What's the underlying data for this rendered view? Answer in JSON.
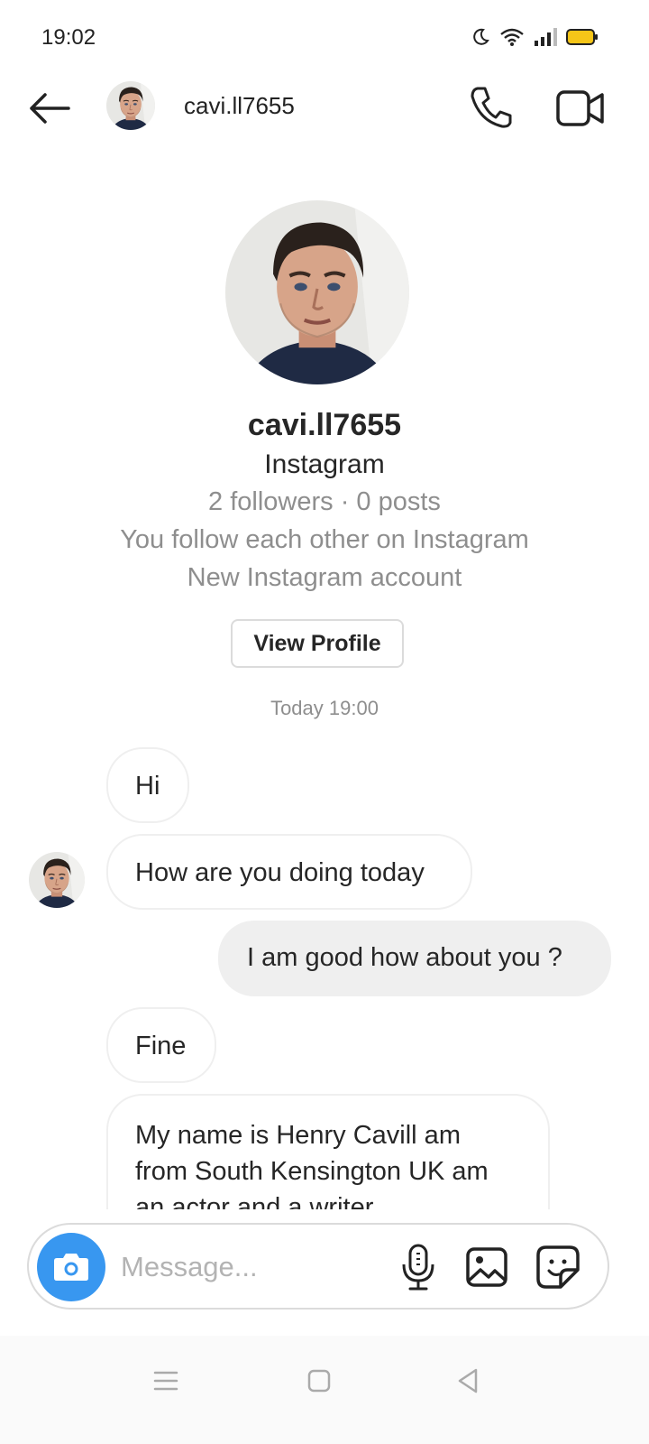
{
  "status_bar": {
    "time": "19:02",
    "icons": [
      "moon-icon",
      "wifi-icon",
      "signal-icon",
      "battery-icon"
    ]
  },
  "header": {
    "username": "cavi.ll7655",
    "back_icon": "arrow-left-icon",
    "call_icon": "phone-icon",
    "video_icon": "video-camera-icon"
  },
  "profile": {
    "name": "cavi.ll7655",
    "subtitle": "Instagram",
    "stats": "2 followers · 0 posts",
    "mutual": "You follow each other on Instagram",
    "note": "New Instagram account",
    "view_profile_label": "View Profile"
  },
  "chat": {
    "timestamp": "Today 19:00",
    "messages": [
      {
        "from": "them",
        "text": "Hi"
      },
      {
        "from": "them",
        "text": "How are you doing today"
      },
      {
        "from": "me",
        "text": "I am good how about you ?"
      },
      {
        "from": "them",
        "text": "Fine"
      },
      {
        "from": "them",
        "lines": [
          "My name is Henry Cavill am",
          "from South Kensington UK am",
          "an actor and a writer"
        ]
      }
    ]
  },
  "composer": {
    "placeholder": "Message...",
    "icons": [
      "camera-icon",
      "microphone-icon",
      "image-icon",
      "sticker-icon"
    ]
  },
  "nav_bar": {
    "icons": [
      "menu-icon",
      "home-square-icon",
      "back-triangle-icon"
    ]
  },
  "colors": {
    "accent": "#3897f0",
    "bubble_out": "#efefef",
    "bubble_border": "#efefef",
    "muted_text": "#8e8e8e",
    "battery": "#f5c518"
  }
}
